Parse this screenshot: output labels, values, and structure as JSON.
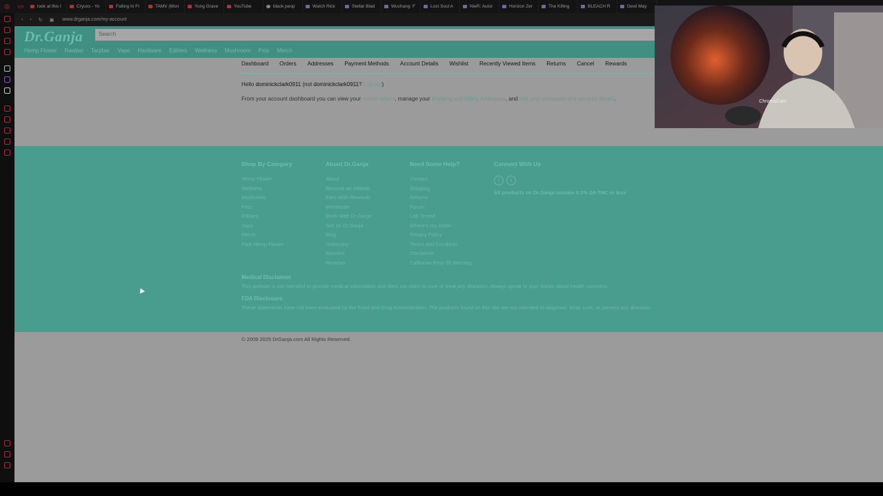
{
  "tabs": [
    {
      "label": "look at this I",
      "icon": "youtube"
    },
    {
      "label": "Cryuxs - Yo",
      "icon": "youtube"
    },
    {
      "label": "Falling In Fr",
      "icon": "youtube"
    },
    {
      "label": "TAMV (Mon",
      "icon": "youtube"
    },
    {
      "label": "Yung Grave",
      "icon": "youtube"
    },
    {
      "label": "YouTube",
      "icon": "youtube"
    },
    {
      "label": "black peop",
      "icon": "search"
    },
    {
      "label": "Watch Rick",
      "icon": "generic"
    },
    {
      "label": "Stellar Blad",
      "icon": "generic"
    },
    {
      "label": "Wuchang: F",
      "icon": "generic"
    },
    {
      "label": "Lost Soul A",
      "icon": "generic"
    },
    {
      "label": "NieR: Autor",
      "icon": "generic"
    },
    {
      "label": "Horizon Zer",
      "icon": "generic"
    },
    {
      "label": "The Killing",
      "icon": "generic"
    },
    {
      "label": "BLEACH R",
      "icon": "generic"
    },
    {
      "label": "Devil May",
      "icon": "generic"
    }
  ],
  "url": "www.drganja.com/my-account",
  "header": {
    "logo": "Dr.Ganja",
    "search_placeholder": "Search",
    "nav": [
      "Hemp Flower",
      "Rawbar",
      "Tarpbar",
      "Vape",
      "Hardware",
      "Edibles",
      "Wellness",
      "Mushroom",
      "Pets",
      "Merch"
    ]
  },
  "account_nav": [
    "Dashboard",
    "Orders",
    "Addresses",
    "Payment Methods",
    "Account Details",
    "Wishlist",
    "Recently Viewed Items",
    "Returns",
    "Cancel",
    "Rewards"
  ],
  "dashboard": {
    "hello_prefix": "Hello",
    "username": "dominickclark0911",
    "not_prefix": "(not",
    "not_user": "dominickclark0911",
    "not_suffix": "?",
    "logout": "Log out",
    "close": ")",
    "from_text": "From your account dashboard you can view your",
    "recent_orders": "recent orders",
    "manage": ", manage your",
    "addresses": "shipping and billing addresses",
    "and": ", and",
    "edit": "edit your password and account details",
    "end": "."
  },
  "footer": {
    "columns": [
      {
        "title": "Shop By Category",
        "items": [
          "Hemp Flower",
          "Wellness",
          "Mushroom",
          "Pets",
          "Edibles",
          "Vape",
          "Merch",
          "Past Hemp Flower"
        ]
      },
      {
        "title": "About Dr.Ganja",
        "items": [
          "About",
          "Become an Affiliate",
          "Earn With Rewards",
          "Wholesale",
          "Work With Dr.Ganja",
          "Sell on Dr.Ganja",
          "Blog",
          "Dictionary",
          "Banners",
          "Reviews"
        ]
      },
      {
        "title": "Need Some Help?",
        "items": [
          "Contact",
          "Shipping",
          "Returns",
          "Forum",
          "Lab Tested",
          "Where's my Order",
          "Privacy Policy",
          "Terms and Condition",
          "Disclaimer",
          "California Prop 65 Warning"
        ]
      }
    ],
    "connect_title": "Connect With Us",
    "social": [
      "f",
      "x"
    ],
    "thc_note": "All products on Dr.Ganja contain 0.3% Δ9-THC or less",
    "medical_title": "Medical Disclaimer",
    "medical_text": "This website is not intended to provide medical information and does not claim to cure or treat any diseases. Always speak to your doctor about health concerns.",
    "fda_title": "FDA Disclosure",
    "fda_text": "These statements have not been evaluated by the Food and Drug Administration. The products found on this site are not intended to diagnose, treat, cure, or prevent any diseases.",
    "copyright": "© 2009 2025 DrGanja.com All Rights Reserved."
  },
  "webcam_label": "ChromaCam"
}
